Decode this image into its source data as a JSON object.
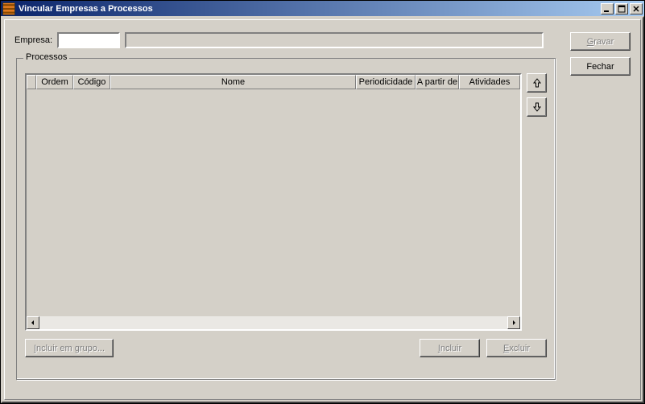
{
  "titlebar": {
    "title": "Vincular Empresas a Processos"
  },
  "form": {
    "empresa_label": "Empresa:"
  },
  "groupbox": {
    "title": "Processos"
  },
  "columns": {
    "ordem": "Ordem",
    "codigo": "Código",
    "nome": "Nome",
    "periodicidade": "Periodicidade",
    "apartir": "A partir de",
    "atividades": "Atividades"
  },
  "buttons": {
    "gravar": "Gravar",
    "fechar": "Fechar",
    "incluir_grupo": "Incluir em grupo...",
    "incluir": "Incluir",
    "excluir": "Excluir"
  }
}
